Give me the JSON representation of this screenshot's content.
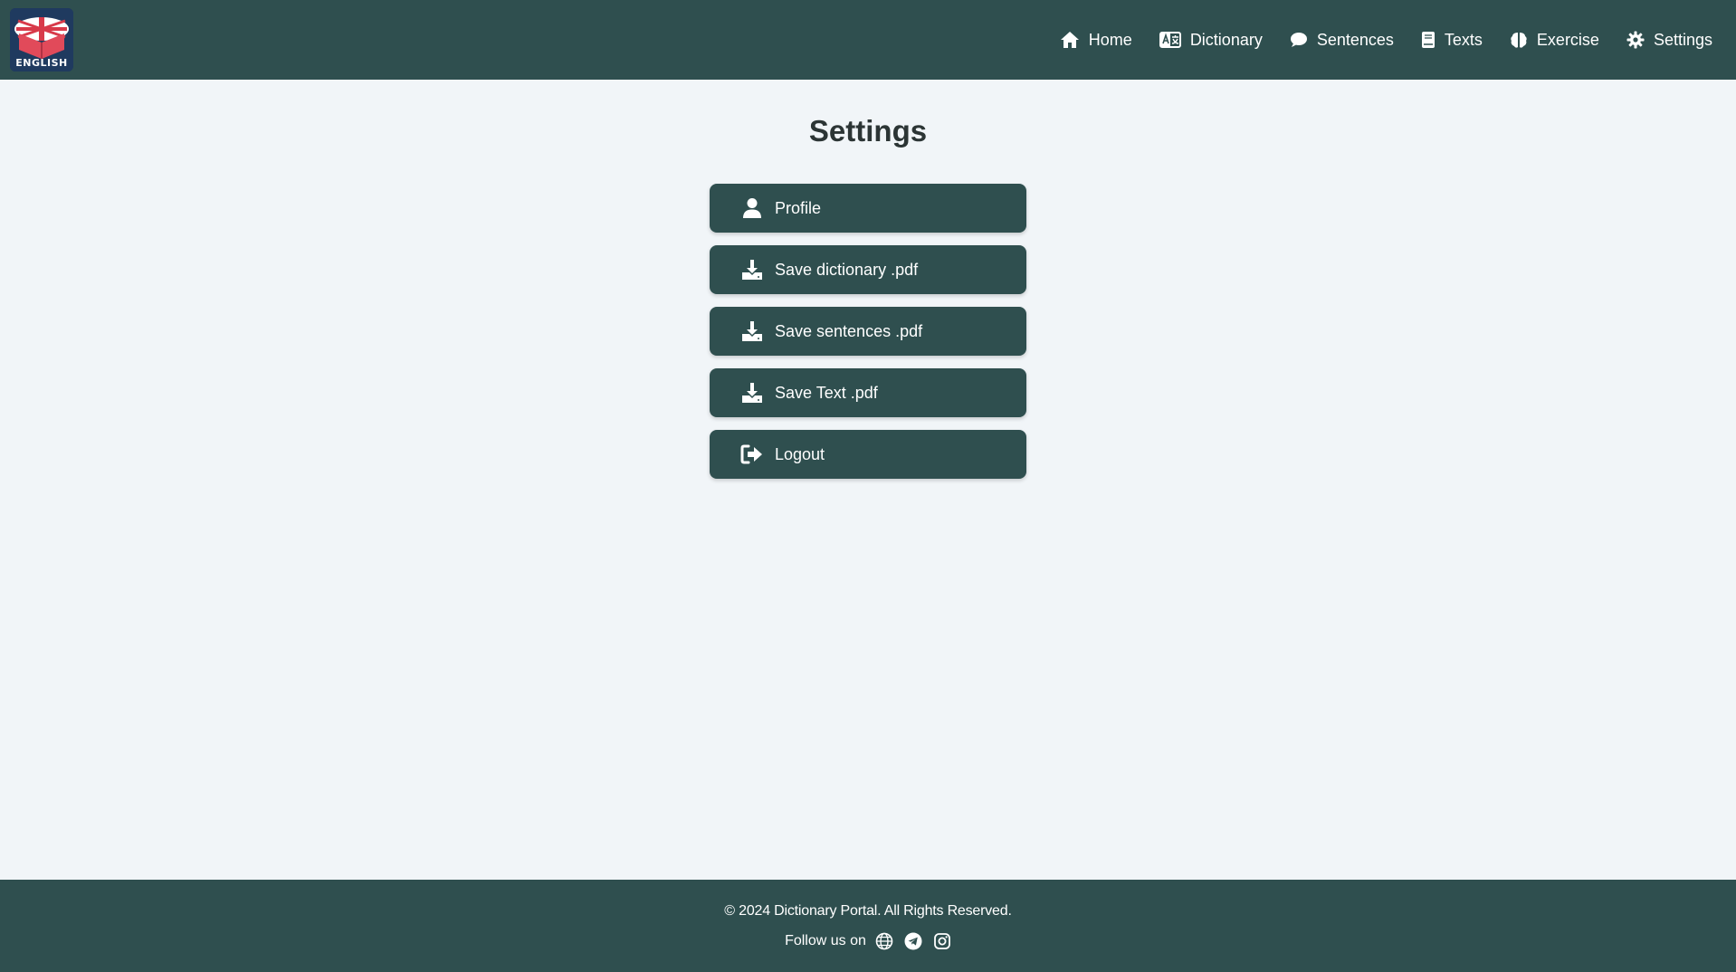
{
  "header": {
    "logo_text": "ENGLISH",
    "nav": [
      {
        "label": "Home",
        "icon": "home-icon"
      },
      {
        "label": "Dictionary",
        "icon": "language-card-icon"
      },
      {
        "label": "Sentences",
        "icon": "comment-icon"
      },
      {
        "label": "Texts",
        "icon": "book-icon"
      },
      {
        "label": "Exercise",
        "icon": "brain-icon"
      },
      {
        "label": "Settings",
        "icon": "gear-icon"
      }
    ]
  },
  "main": {
    "title": "Settings",
    "buttons": [
      {
        "label": "Profile",
        "icon": "user-icon"
      },
      {
        "label": "Save dictionary .pdf",
        "icon": "download-icon"
      },
      {
        "label": "Save sentences .pdf",
        "icon": "download-icon"
      },
      {
        "label": "Save Text .pdf",
        "icon": "download-icon"
      },
      {
        "label": "Logout",
        "icon": "logout-icon"
      }
    ]
  },
  "footer": {
    "copyright": "© 2024 Dictionary Portal. All Rights Reserved.",
    "follow": "Follow us on",
    "social": [
      "globe-icon",
      "telegram-icon",
      "instagram-icon"
    ]
  },
  "colors": {
    "header_bg": "#2f4f4f",
    "page_bg": "#f1f5f8",
    "button_bg": "#2f4f4f",
    "text_light": "#ffffff"
  }
}
